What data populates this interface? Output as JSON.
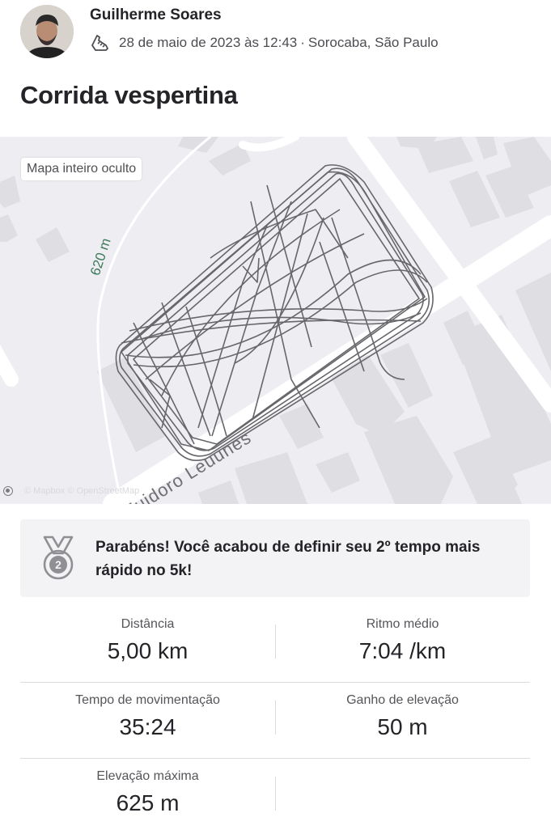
{
  "header": {
    "athlete_name": "Guilherme Soares",
    "activity_icon": "running-shoe-icon",
    "date": "28 de maio de 2023 às 12:43",
    "separator": "·",
    "location": "Sorocaba, São Paulo",
    "activity_title": "Corrida vespertina"
  },
  "map": {
    "privacy_label": "Mapa inteiro oculto",
    "elevation_label": "620 m",
    "street_label": "Euidoro Leuunes",
    "attribution": "© Mapbox © OpenStreetMap",
    "route_color": "#66666b",
    "background_color": "#eeeef2"
  },
  "achievement": {
    "icon": "silver-medal-2-icon",
    "text": "Parabéns! Você acabou de definir seu 2º tempo mais rápido no 5k!"
  },
  "stats": [
    {
      "label": "Distância",
      "value": "5,00 km"
    },
    {
      "label": "Ritmo médio",
      "value": "7:04 /km"
    },
    {
      "label": "Tempo de movimentação",
      "value": "35:24"
    },
    {
      "label": "Ganho de elevação",
      "value": "50 m"
    },
    {
      "label": "Elevação máxima",
      "value": "625 m"
    }
  ]
}
